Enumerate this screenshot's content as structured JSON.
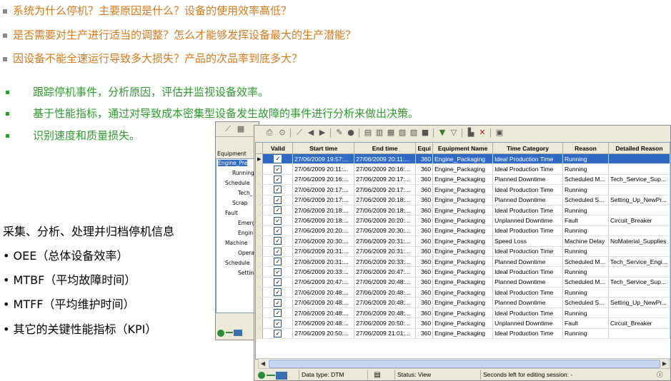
{
  "questions": [
    "系统为什么停机？主要原因是什么？设备的使用效率高低？",
    "是否需要对生产进行适当的调整？怎么才能够发挥设备最大的生产潜能？",
    "因设备不能全速运行导致多大损失？产品的次品率到底多大？"
  ],
  "benefits": [
    "跟踪停机事件，分析原因，评估并监视设备效率。",
    "基于性能指标，通过对导致成本密集型设备发生故障的事件进行分析来做出决策。",
    "识别速度和质量损失。"
  ],
  "kpi": {
    "title": "采集、分析、处理并归档停机信息",
    "items": [
      "• OEE（总体设备效率）",
      "• MTBF（平均故障时间）",
      "• MTFF（平均维护时间）",
      "• 其它的关键性能指标（KPI）"
    ]
  },
  "back_window": {
    "tree_header": "Equipment",
    "tree": [
      {
        "label": "Engine_Pre",
        "selected": true
      },
      {
        "label": "Running"
      },
      {
        "label": "Schedule"
      },
      {
        "label": "Tech_"
      },
      {
        "label": "Scrap"
      },
      {
        "label": "Fault"
      },
      {
        "label": "Emerg"
      },
      {
        "label": "Engin"
      },
      {
        "label": "Machine"
      },
      {
        "label": "Opera"
      },
      {
        "label": "Schedule"
      },
      {
        "label": "Settin"
      }
    ]
  },
  "grid": {
    "columns": [
      "Valid",
      "Start time",
      "End time",
      "Equi",
      "Equipment Name",
      "Time Category",
      "Reason",
      "Detailed Reason"
    ],
    "rows": [
      {
        "start": "27/06/2009 19:57:...",
        "end": "27/06/2009 20:11:...",
        "equi": "360",
        "name": "Engine_Packaging",
        "cat": "Ideal Production Time",
        "reason": "Running",
        "detail": "",
        "selected": true
      },
      {
        "start": "27/06/2009 20:11:...",
        "end": "27/06/2009 20:16:...",
        "equi": "360",
        "name": "Engine_Packaging",
        "cat": "Ideal Production Time",
        "reason": "Running",
        "detail": ""
      },
      {
        "start": "27/06/2009 20:16:...",
        "end": "27/06/2009 20:17:...",
        "equi": "360",
        "name": "Engine_Packaging",
        "cat": "Planned Downtime",
        "reason": "Scheduled M...",
        "detail": "Tech_Service_Sup..."
      },
      {
        "start": "27/06/2009 20:17:...",
        "end": "27/06/2009 20:17:...",
        "equi": "360",
        "name": "Engine_Packaging",
        "cat": "Ideal Production Time",
        "reason": "Running",
        "detail": ""
      },
      {
        "start": "27/06/2009 20:17:...",
        "end": "27/06/2009 20:18:...",
        "equi": "360",
        "name": "Engine_Packaging",
        "cat": "Planned Downtime",
        "reason": "Scheduled S...",
        "detail": "Setting_Up_NewPr..."
      },
      {
        "start": "27/06/2009 20:18:...",
        "end": "27/06/2009 20:18:...",
        "equi": "360",
        "name": "Engine_Packaging",
        "cat": "Ideal Production Time",
        "reason": "Running",
        "detail": ""
      },
      {
        "start": "27/06/2009 20:18:...",
        "end": "27/06/2009 20:20:...",
        "equi": "360",
        "name": "Engine_Packaging",
        "cat": "Unplanned Downtime",
        "reason": "Fault",
        "detail": "Circuit_Breaker"
      },
      {
        "start": "27/06/2009 20:20:...",
        "end": "27/06/2009 20:30:...",
        "equi": "360",
        "name": "Engine_Packaging",
        "cat": "Ideal Production Time",
        "reason": "Running",
        "detail": ""
      },
      {
        "start": "27/06/2009 20:30:...",
        "end": "27/06/2009 20:31:...",
        "equi": "360",
        "name": "Engine_Packaging",
        "cat": "Speed Loss",
        "reason": "Machine Delay",
        "detail": "NoMaterial_Supplies"
      },
      {
        "start": "27/06/2009 20:31:...",
        "end": "27/06/2009 20:31:...",
        "equi": "360",
        "name": "Engine_Packaging",
        "cat": "Ideal Production Time",
        "reason": "Running",
        "detail": ""
      },
      {
        "start": "27/06/2009 20:31:...",
        "end": "27/06/2009 20:33:...",
        "equi": "360",
        "name": "Engine_Packaging",
        "cat": "Planned Downtime",
        "reason": "Scheduled M...",
        "detail": "Tech_Service_Engi..."
      },
      {
        "start": "27/06/2009 20:33:...",
        "end": "27/06/2009 20:47:...",
        "equi": "360",
        "name": "Engine_Packaging",
        "cat": "Ideal Production Time",
        "reason": "Running",
        "detail": ""
      },
      {
        "start": "27/06/2009 20:47:...",
        "end": "27/06/2009 20:48:...",
        "equi": "360",
        "name": "Engine_Packaging",
        "cat": "Planned Downtime",
        "reason": "Scheduled M...",
        "detail": "Tech_Service_Sup..."
      },
      {
        "start": "27/06/2009 20:48:...",
        "end": "27/06/2009 20:48:...",
        "equi": "360",
        "name": "Engine_Packaging",
        "cat": "Ideal Production Time",
        "reason": "Running",
        "detail": ""
      },
      {
        "start": "27/06/2009 20:48:...",
        "end": "27/06/2009 20:48:...",
        "equi": "360",
        "name": "Engine_Packaging",
        "cat": "Planned Downtime",
        "reason": "Scheduled S...",
        "detail": "Setting_Up_NewPr..."
      },
      {
        "start": "27/06/2009 20:48:...",
        "end": "27/06/2009 20:48:...",
        "equi": "360",
        "name": "Engine_Packaging",
        "cat": "Ideal Production Time",
        "reason": "Running",
        "detail": ""
      },
      {
        "start": "27/06/2009 20:48:...",
        "end": "27/06/2009 20:50:...",
        "equi": "360",
        "name": "Engine_Packaging",
        "cat": "Unplanned Downtime",
        "reason": "Fault",
        "detail": "Circuit_Breaker"
      },
      {
        "start": "27/06/2009 20:50:...",
        "end": "27/06/2009 21:01:...",
        "equi": "360",
        "name": "Engine_Packaging",
        "cat": "Ideal Production Time",
        "reason": "Running",
        "detail": ""
      }
    ]
  },
  "statusbar": {
    "data_type": "Data type: DTM",
    "status": "Status: View",
    "seconds": "Seconds left for editing session: -"
  },
  "colors": {
    "question_text": "#d97a1f",
    "benefit_text": "#2e9a2e",
    "selection": "#316ac5"
  }
}
